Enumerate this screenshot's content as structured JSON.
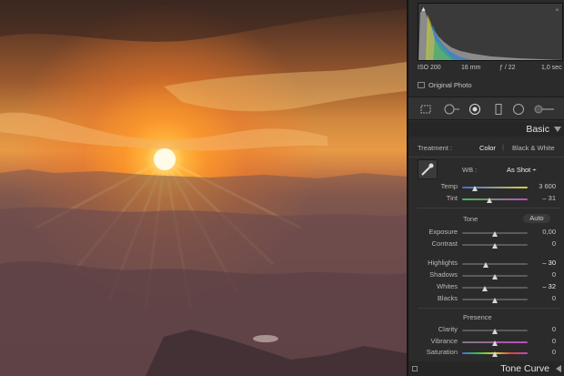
{
  "histogram": {
    "iso": "ISO 200",
    "focal": "16 mm",
    "aperture": "ƒ / 22",
    "shutter": "1,0 sec",
    "original_photo": "Original Photo"
  },
  "basic": {
    "title": "Basic",
    "treatment_label": "Treatment :",
    "color": "Color",
    "bw": "Black & White",
    "wb_label": "WB :",
    "wb_value": "As Shot ÷",
    "temp_label": "Temp",
    "temp_value": "3 600",
    "tint_label": "Tint",
    "tint_value": "– 31",
    "tone_label": "Tone",
    "auto": "Auto",
    "exposure_label": "Exposure",
    "exposure_value": "0,00",
    "contrast_label": "Contrast",
    "contrast_value": "0",
    "highlights_label": "Highlights",
    "highlights_value": "– 30",
    "shadows_label": "Shadows",
    "shadows_value": "0",
    "whites_label": "Whites",
    "whites_value": "– 32",
    "blacks_label": "Blacks",
    "blacks_value": "0",
    "presence_label": "Presence",
    "clarity_label": "Clarity",
    "clarity_value": "0",
    "vibrance_label": "Vibrance",
    "vibrance_value": "0",
    "saturation_label": "Saturation",
    "saturation_value": "0"
  },
  "tone_curve": {
    "title": "Tone Curve"
  },
  "colors": {
    "panel": "#2b2b2b",
    "accent_text": "#e2e2e2"
  }
}
